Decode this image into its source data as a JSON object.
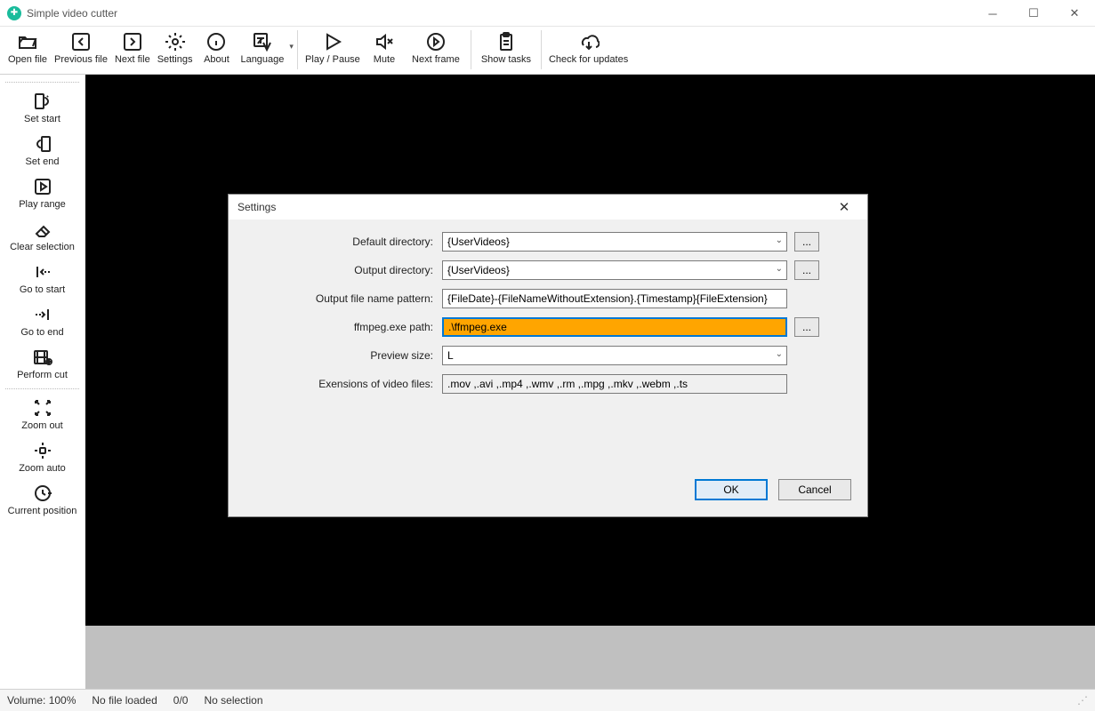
{
  "app": {
    "title": "Simple video cutter"
  },
  "toolbar": {
    "open_file": "Open file",
    "previous_file": "Previous file",
    "next_file": "Next file",
    "settings": "Settings",
    "about": "About",
    "language": "Language",
    "play_pause": "Play / Pause",
    "mute": "Mute",
    "next_frame": "Next frame",
    "show_tasks": "Show tasks",
    "check_updates": "Check for updates"
  },
  "sidebar": {
    "set_start": "Set start",
    "set_end": "Set end",
    "play_range": "Play range",
    "clear_selection": "Clear selection",
    "go_to_start": "Go to start",
    "go_to_end": "Go to end",
    "perform_cut": "Perform cut",
    "zoom_out": "Zoom out",
    "zoom_auto": "Zoom auto",
    "current_position": "Current position"
  },
  "statusbar": {
    "volume": "Volume: 100%",
    "file": "No file loaded",
    "counter": "0/0",
    "selection": "No selection"
  },
  "dialog": {
    "title": "Settings",
    "labels": {
      "default_dir": "Default directory:",
      "output_dir": "Output directory:",
      "pattern": "Output file name pattern:",
      "ffmpeg": "ffmpeg.exe path:",
      "preview": "Preview size:",
      "extensions": "Exensions of video files:"
    },
    "values": {
      "default_dir": "{UserVideos}",
      "output_dir": "{UserVideos}",
      "pattern": "{FileDate}-{FileNameWithoutExtension}.{Timestamp}{FileExtension}",
      "ffmpeg": ".\\ffmpeg.exe",
      "preview": "L",
      "extensions": ".mov ,.avi ,.mp4 ,.wmv ,.rm ,.mpg ,.mkv ,.webm ,.ts"
    },
    "browse": "...",
    "ok": "OK",
    "cancel": "Cancel"
  }
}
